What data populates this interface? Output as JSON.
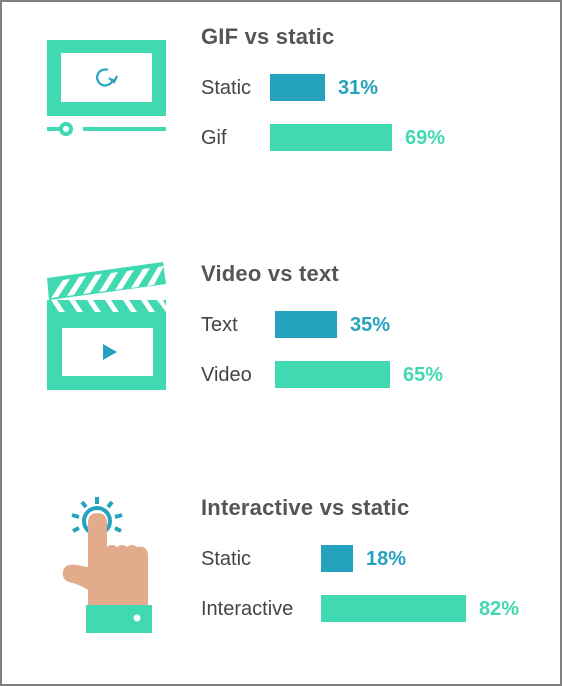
{
  "colors": {
    "primary": "#41D9B2",
    "secondary": "#25A2BE",
    "title": "#555555",
    "label": "#444444",
    "skin": "#E2AC8C"
  },
  "chart_data": [
    {
      "type": "bar",
      "orientation": "horizontal",
      "title": "GIF vs static",
      "icon": "monitor-replay-icon",
      "categories": [
        "Static",
        "Gif"
      ],
      "values": [
        31,
        69
      ],
      "value_labels": [
        "31%",
        "69%"
      ],
      "unit": "%",
      "xlim": [
        0,
        100
      ]
    },
    {
      "type": "bar",
      "orientation": "horizontal",
      "title": "Video vs text",
      "icon": "clapperboard-icon",
      "categories": [
        "Text",
        "Video"
      ],
      "values": [
        35,
        65
      ],
      "value_labels": [
        "35%",
        "65%"
      ],
      "unit": "%",
      "xlim": [
        0,
        100
      ]
    },
    {
      "type": "bar",
      "orientation": "horizontal",
      "title": "Interactive vs static",
      "icon": "pointing-hand-icon",
      "categories": [
        "Static",
        "Interactive"
      ],
      "values": [
        18,
        82
      ],
      "value_labels": [
        "18%",
        "82%"
      ],
      "unit": "%",
      "xlim": [
        0,
        100
      ]
    }
  ]
}
